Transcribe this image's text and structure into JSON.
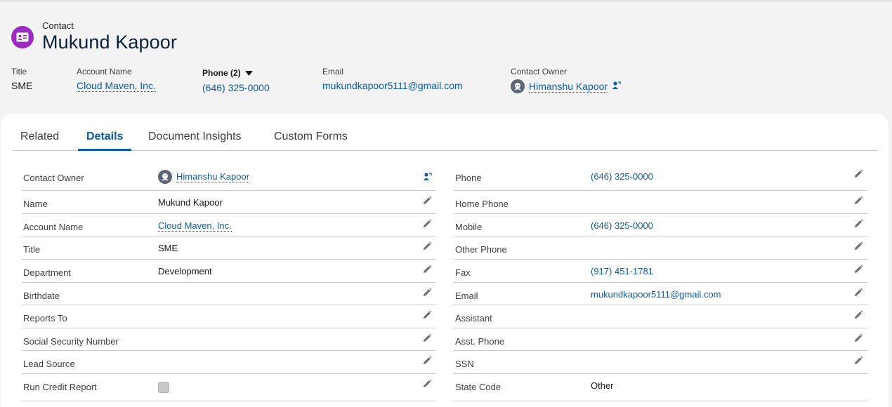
{
  "header": {
    "object_label": "Contact",
    "record_name": "Mukund Kapoor",
    "highlights": {
      "title": {
        "label": "Title",
        "value": "SME"
      },
      "account_name": {
        "label": "Account Name",
        "value": "Cloud Maven, Inc."
      },
      "phone": {
        "label": "Phone (2)",
        "value": "(646) 325-0000"
      },
      "email": {
        "label": "Email",
        "value": "mukundkapoor5111@gmail.com"
      },
      "contact_owner": {
        "label": "Contact Owner",
        "value": "Himanshu Kapoor"
      }
    }
  },
  "tabs": [
    {
      "label": "Related"
    },
    {
      "label": "Details"
    },
    {
      "label": "Document Insights"
    },
    {
      "label": "Custom Forms"
    }
  ],
  "details": {
    "left": [
      {
        "label": "Contact Owner",
        "value": "Himanshu Kapoor"
      },
      {
        "label": "Name",
        "value": "Mukund Kapoor"
      },
      {
        "label": "Account Name",
        "value": "Cloud Maven, Inc."
      },
      {
        "label": "Title",
        "value": "SME"
      },
      {
        "label": "Department",
        "value": "Development"
      },
      {
        "label": "Birthdate",
        "value": ""
      },
      {
        "label": "Reports To",
        "value": ""
      },
      {
        "label": "Social Security Number",
        "value": ""
      },
      {
        "label": "Lead Source",
        "value": ""
      },
      {
        "label": "Run Credit Report",
        "value": ""
      }
    ],
    "right": [
      {
        "label": "Phone",
        "value": "(646) 325-0000"
      },
      {
        "label": "Home Phone",
        "value": ""
      },
      {
        "label": "Mobile",
        "value": "(646) 325-0000"
      },
      {
        "label": "Other Phone",
        "value": ""
      },
      {
        "label": "Fax",
        "value": "(917) 451-1781"
      },
      {
        "label": "Email",
        "value": "mukundkapoor5111@gmail.com"
      },
      {
        "label": "Assistant",
        "value": ""
      },
      {
        "label": "Asst. Phone",
        "value": ""
      },
      {
        "label": "SSN",
        "value": ""
      },
      {
        "label": "State Code",
        "value": "Other"
      }
    ]
  },
  "colors": {
    "accent": "#0b5cab",
    "contact_icon": "#9c2bc1"
  },
  "icons": [
    "contact-card-icon",
    "caret-down-icon",
    "user-avatar-icon",
    "change-owner-icon",
    "pencil-edit-icon"
  ]
}
